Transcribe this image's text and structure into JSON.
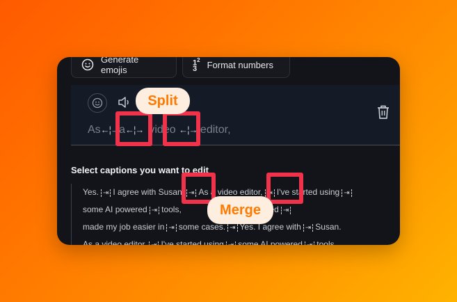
{
  "toolbar": {
    "generate_emojis_label": "Generate emojis",
    "format_numbers_label": "Format numbers"
  },
  "editor": {
    "caption_text_before": "As",
    "caption_word_2": "a",
    "caption_word_3": "vi",
    "caption_word_4": "deo",
    "caption_word_5": "editor,"
  },
  "section": {
    "title": "Select captions you want to edit"
  },
  "captions": {
    "line1_a": "Yes.",
    "line1_b": "I agree with Susan.",
    "line1_c": "As a video editor,",
    "line1_d": "I've started using",
    "line2_a": "some AI powered",
    "line2_b": "tools,",
    "line2_c": "eed",
    "line3_a": "made my job easier in",
    "line3_b": "some cases.",
    "line3_c": "Yes. I agree with",
    "line3_d": "Susan.",
    "line4_a": "As a video editor,",
    "line4_b": "I've started using",
    "line4_c": "some AI powered",
    "line4_d": "tools,"
  },
  "annotations": {
    "split_label": "Split",
    "merge_label": "Merge"
  },
  "colors": {
    "annotation_red": "#f0324b",
    "annotation_orange": "#ff7a00",
    "card_bg": "#121419"
  }
}
